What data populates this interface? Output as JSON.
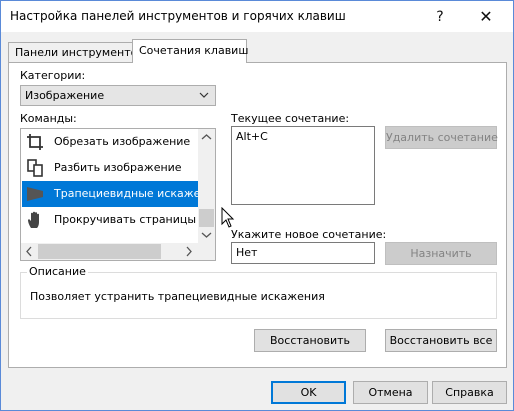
{
  "window": {
    "title": "Настройка панелей инструментов и горячих клавиш",
    "help_glyph": "?",
    "close_glyph": "✕"
  },
  "tabs": [
    {
      "label": "Панели инструментов",
      "selected": false
    },
    {
      "label": "Сочетания клавиш",
      "selected": true
    }
  ],
  "categories": {
    "label": "Категории:",
    "selected": "Изображение"
  },
  "commands": {
    "label": "Команды:",
    "items": [
      {
        "label": "Обрезать изображение",
        "icon": "crop-icon",
        "selected": false
      },
      {
        "label": "Разбить изображение",
        "icon": "split-image-icon",
        "selected": false
      },
      {
        "label": "Трапециевидные искажения",
        "icon": "keystone-icon",
        "selected": true
      },
      {
        "label": "Прокручивать страницы",
        "icon": "hand-icon",
        "selected": false
      }
    ]
  },
  "current_shortcut": {
    "label": "Текущее сочетание:",
    "value": "Alt+C",
    "delete_button": "Удалить сочетание"
  },
  "new_shortcut": {
    "label": "Укажите новое сочетание:",
    "value": "Нет",
    "assign_button": "Назначить"
  },
  "description": {
    "title": "Описание",
    "text": "Позволяет устранить трапециевидные искажения"
  },
  "panel_buttons": {
    "restore": "Восстановить",
    "restore_all": "Восстановить все"
  },
  "footer": {
    "ok": "OK",
    "cancel": "Отмена",
    "help": "Справка"
  },
  "colors": {
    "selection": "#0078d7",
    "window_border": "#5a8ad8"
  }
}
